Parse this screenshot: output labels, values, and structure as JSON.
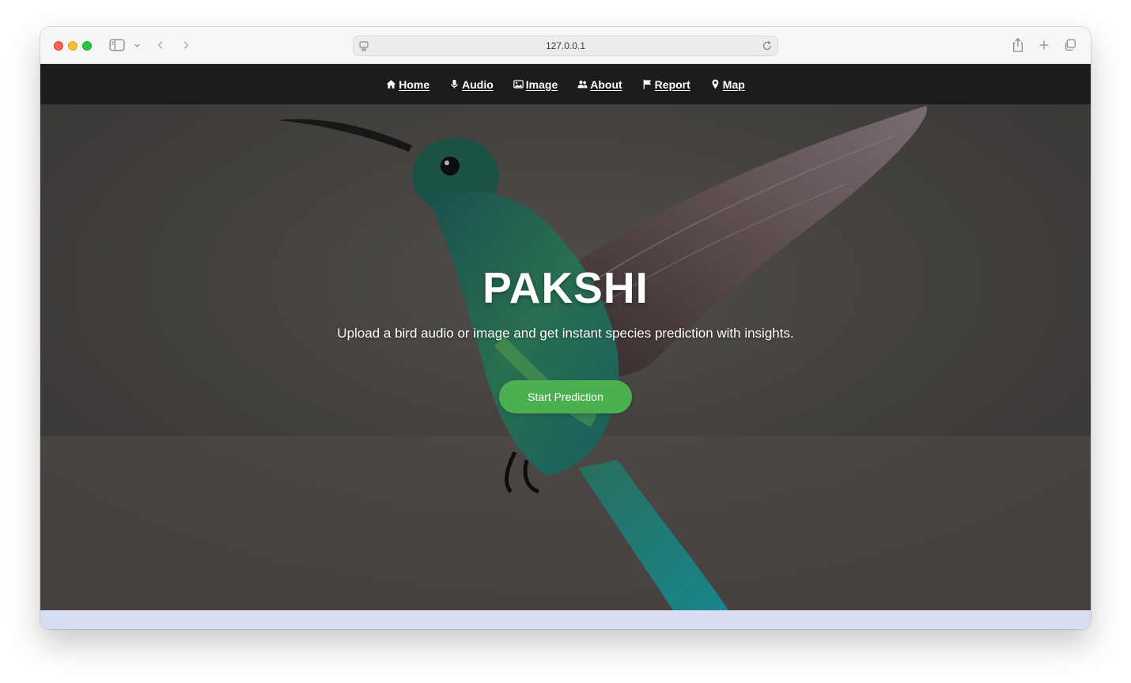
{
  "browser": {
    "address": "127.0.0.1",
    "icons": [
      "sidebar-icon",
      "chevron-down-icon",
      "back-icon",
      "forward-icon",
      "page-icon",
      "reload-icon",
      "share-icon",
      "plus-icon",
      "tabs-icon"
    ]
  },
  "nav": {
    "items": [
      {
        "label": "Home",
        "icon": "home-icon"
      },
      {
        "label": "Audio",
        "icon": "microphone-icon"
      },
      {
        "label": "Image",
        "icon": "image-icon"
      },
      {
        "label": "About",
        "icon": "users-icon"
      },
      {
        "label": "Report",
        "icon": "flag-icon"
      },
      {
        "label": "Map",
        "icon": "map-pin-icon"
      }
    ]
  },
  "hero": {
    "title": "PAKSHI",
    "subtitle": "Upload a bird audio or image and get instant species prediction with insights.",
    "cta_label": "Start Prediction"
  },
  "colors": {
    "nav_bg": "#1c1c1c",
    "cta_bg": "#4caf50",
    "hero_bg": "#55504d"
  }
}
